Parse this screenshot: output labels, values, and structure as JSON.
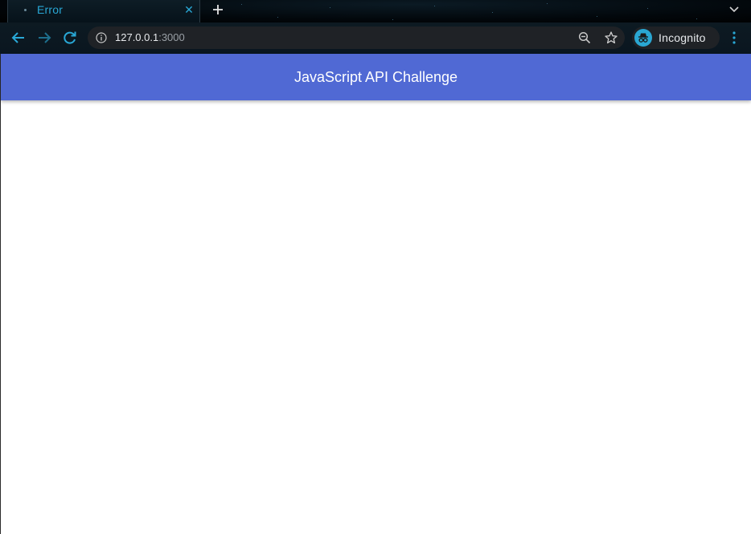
{
  "browser": {
    "tab": {
      "title": "Error",
      "close_icon": "close-icon"
    },
    "new_tab_icon": "plus-icon",
    "tab_search_icon": "chevron-down-icon",
    "toolbar": {
      "back_icon": "arrow-left-icon",
      "forward_icon": "arrow-right-icon",
      "reload_icon": "reload-icon",
      "address": {
        "host": "127.0.0.1",
        "port": ":3000",
        "info_icon": "info-icon",
        "zoom_icon": "zoom-out-icon",
        "bookmark_icon": "star-icon"
      },
      "profile": {
        "label": "Incognito",
        "icon": "incognito-icon"
      },
      "menu_icon": "kebab-menu-icon"
    },
    "colors": {
      "accent": "#29a8d6",
      "omnibox_bg": "#1f2226",
      "toolbar_bg": "#0d1a22"
    }
  },
  "page": {
    "app_bar": {
      "title": "JavaScript API Challenge",
      "color": "#5069d4"
    }
  }
}
